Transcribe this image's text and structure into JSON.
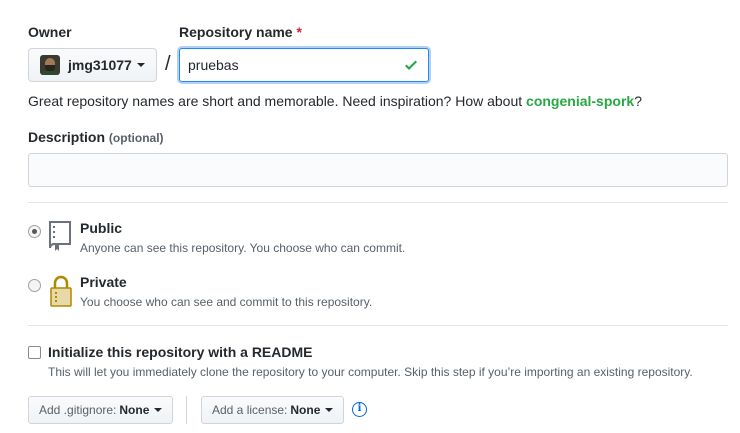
{
  "owner": {
    "label": "Owner",
    "name": "jmg31077"
  },
  "separator": "/",
  "repo": {
    "label": "Repository name",
    "required_mark": "*",
    "value": "pruebas"
  },
  "hint": {
    "prefix": "Great repository names are short and memorable. Need inspiration? How about ",
    "suggestion": "congenial-spork",
    "suffix": "?"
  },
  "description": {
    "label": "Description",
    "optional": "(optional)",
    "value": ""
  },
  "visibility": {
    "public": {
      "title": "Public",
      "note": "Anyone can see this repository. You choose who can commit.",
      "selected": true
    },
    "private": {
      "title": "Private",
      "note": "You choose who can see and commit to this repository.",
      "selected": false
    }
  },
  "readme": {
    "title": "Initialize this repository with a README",
    "note": "This will let you immediately clone the repository to your computer. Skip this step if you’re importing an existing repository.",
    "checked": false
  },
  "gitignore": {
    "label": "Add .gitignore:",
    "value": "None"
  },
  "license": {
    "label": "Add a license:",
    "value": "None"
  },
  "colors": {
    "success": "#28a745",
    "focus": "#2188ff",
    "required": "#cb2431",
    "info": "#0366d6"
  },
  "icons": [
    "check-icon",
    "repo-icon",
    "lock-icon",
    "info-icon",
    "caret-down-icon"
  ]
}
